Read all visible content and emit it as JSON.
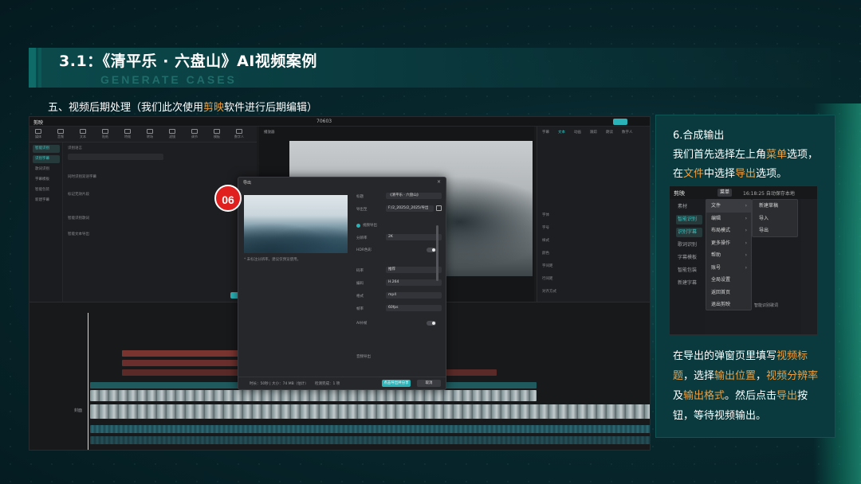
{
  "slide": {
    "title": "3.1：《清平乐 · 六盘山》AI视频案例",
    "subtitle": "GENERATE CASES",
    "section_pre": "五、视频后期处理（我们此次使用",
    "section_hl": "剪映",
    "section_post": "软件进行后期编辑）"
  },
  "app": {
    "logo": "剪映",
    "title": "70603",
    "tools": [
      "媒体",
      "音频",
      "文本",
      "贴纸",
      "特效",
      "转场",
      "滤镜",
      "调节",
      "模板",
      "数字人"
    ],
    "left_nav": [
      "智能识别",
      "识别字幕",
      "歌词识别",
      "字幕模板",
      "智能包装",
      "新建字幕"
    ],
    "left_panel": {
      "label1": "识别语言",
      "label2": "同时识别双语字幕",
      "label3": "标记无效片段",
      "label4": "智能识别歌词",
      "label5": "智能文本导出",
      "button": "开始识别"
    },
    "player_label": "播放器",
    "right_tabs": [
      "字幕",
      "文本",
      "动画",
      "跟踪",
      "朗读",
      "数字人"
    ],
    "right_rows": [
      "字体",
      "字号",
      "样式",
      "颜色",
      "字间距",
      "行间距",
      "对齐方式"
    ],
    "timeline_label": "封面"
  },
  "dialog": {
    "title": "导出",
    "close": "×",
    "thumb_note": "* 未标注分辨率，建议仅预览使用。",
    "fields": [
      {
        "label": "标题",
        "value": "《清平乐 · 六盘山》"
      },
      {
        "label": "导出至",
        "value": "F:/2_2025/2_2025/导出"
      },
      {
        "label": "分辨率",
        "value": "2K"
      },
      {
        "label": "码率",
        "value": "推荐"
      },
      {
        "label": "编码",
        "value": "H.264"
      },
      {
        "label": "格式",
        "value": "mp4"
      },
      {
        "label": "帧率",
        "value": "60fps"
      }
    ],
    "video_export": "视频导出",
    "hdr_label": "HDR色彩",
    "ai_label": "AI补帧",
    "audio_export": "音频导出",
    "footer_info": "时长：50秒 | 大小：74 MB（估计）",
    "footer_check": "检测完成：1 项",
    "export_button": "点击导出并分享",
    "cancel_button": "取消"
  },
  "badge": "06",
  "info": {
    "heading": "6.合成输出",
    "line2_pre": "我们首先选择左上角",
    "line2_hl": "菜单",
    "line2_post": "选项，",
    "line3_pre": "在",
    "line3_hl1": "文件",
    "line3_mid": "中选择",
    "line3_hl2": "导出",
    "line3_post": "选项。",
    "body": {
      "p1": "在导出的弹窗页里填写",
      "h1": "视频标题",
      "p2": "，选择",
      "h2": "输出位置",
      "p3": "，",
      "h3": "视频分辨率",
      "p4": "及",
      "h4": "输出格式",
      "p5": "。然后点击",
      "h5": "导出",
      "p6": "按钮，等待视频输出。"
    }
  },
  "menu_shot": {
    "logo": "剪映",
    "menu_button": "菜单",
    "status": "16:18:25 自动保存本地",
    "side": [
      "素材",
      "智能识别",
      "识别字幕",
      "歌词识别",
      "字幕模板",
      "智能包装",
      "新建字幕"
    ],
    "menu_items": [
      "文件",
      "编辑",
      "布局模式",
      "更多操作",
      "帮助",
      "账号",
      "全局设置",
      "返回首页",
      "退出剪映"
    ],
    "submenu": [
      "新建草稿",
      "导入",
      "导出"
    ],
    "right_note": "智能识别歌词"
  },
  "colors": {
    "accent_orange": "#f0a040",
    "brand_teal": "#2ab3b8",
    "badge_red": "#e0201f"
  }
}
